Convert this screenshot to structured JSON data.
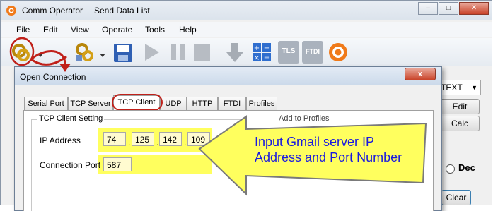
{
  "window": {
    "title": "Comm Operator",
    "subtitle": "Send Data List",
    "minimize_glyph": "–",
    "maximize_glyph": "□",
    "close_glyph": "✕"
  },
  "menu": [
    "File",
    "Edit",
    "View",
    "Operate",
    "Tools",
    "Help"
  ],
  "toolbar": {
    "icons": [
      "connect-icon",
      "connect-dropdown-icon",
      "disconnect-icon",
      "disconnect-dropdown-icon",
      "save-icon",
      "play-icon",
      "pause-icon",
      "stop-icon",
      "download-icon",
      "calculator-icon",
      "tls-icon",
      "ftdi-icon",
      "app-logo-icon"
    ],
    "tls_label": "TLS",
    "ftdi_label": "FTDI"
  },
  "right_panel": {
    "format_value": "TEXT",
    "edit_button": "Edit",
    "calc_button": "Calc",
    "dec_label": "Dec",
    "clear_button": "Clear"
  },
  "dialog": {
    "title": "Open Connection",
    "close_glyph": "x",
    "tabs": [
      "Serial Port",
      "TCP Server",
      "TCP Client",
      "UDP",
      "HTTP",
      "FTDI",
      "Profiles"
    ],
    "active_tab": "TCP Client",
    "group_title": "TCP Client Setting",
    "profiles_hint": "Add to Profiles",
    "ip_label": "IP Address",
    "ip_octets": [
      "74",
      "125",
      "142",
      "109"
    ],
    "port_label": "Connection Port",
    "port_value": "587"
  },
  "callout": {
    "line1": "Input Gmail server IP",
    "line2": "Address and Port Number"
  },
  "colors": {
    "highlight_yellow": "#ffff5e",
    "arrow_red": "#c0201a",
    "callout_text": "#1a1ae0",
    "callout_fill": "#ffff5e"
  }
}
